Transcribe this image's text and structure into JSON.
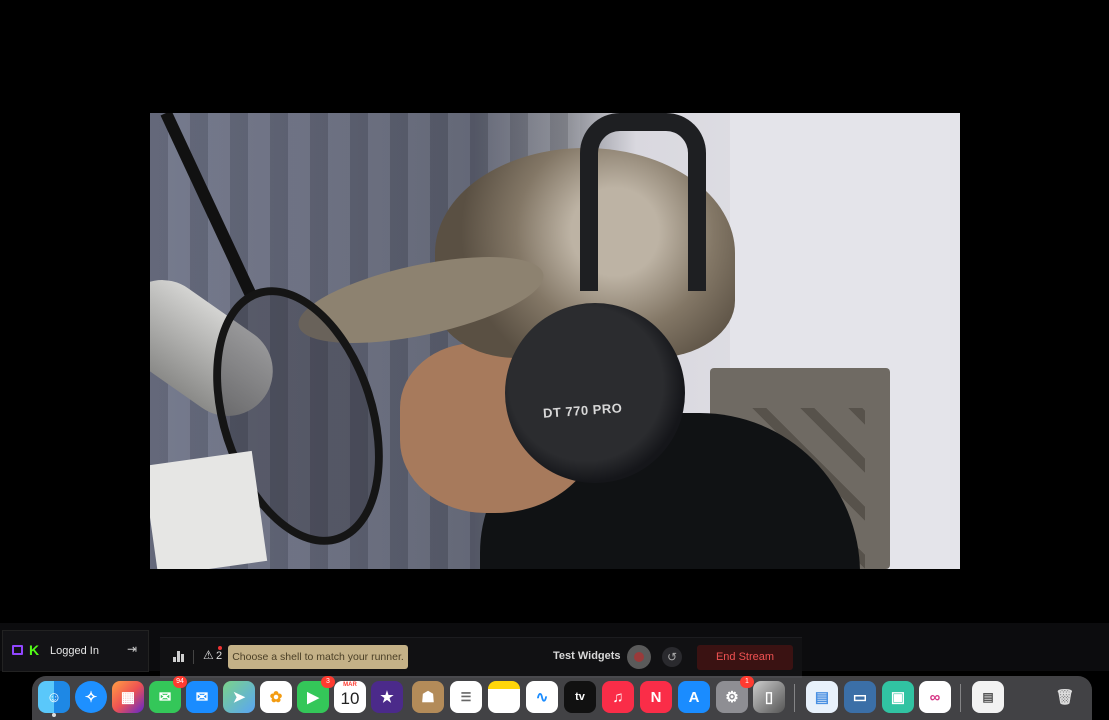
{
  "stream_panel": {
    "headphone_brand_text": "DT 770 PRO"
  },
  "login": {
    "status_label": "Logged In"
  },
  "controls": {
    "warning_count": "2",
    "shell_hint": "Choose a shell to match your runner.",
    "test_widgets_label": "Test Widgets",
    "end_stream_label": "End Stream"
  },
  "dock": {
    "apps": [
      {
        "name": "finder-icon"
      },
      {
        "name": "safari-icon"
      },
      {
        "name": "launchpad-icon"
      },
      {
        "name": "messages-icon",
        "badge": "94"
      },
      {
        "name": "mail-icon"
      },
      {
        "name": "maps-icon"
      },
      {
        "name": "photos-icon"
      },
      {
        "name": "facetime-icon",
        "badge": "3"
      },
      {
        "name": "calendar-icon",
        "month": "MAR",
        "day": "10"
      },
      {
        "name": "imovie-icon"
      },
      {
        "name": "contacts-icon"
      },
      {
        "name": "reminders-icon"
      },
      {
        "name": "notes-icon"
      },
      {
        "name": "freeform-icon"
      },
      {
        "name": "apple-tv-icon",
        "label": "tv"
      },
      {
        "name": "music-icon"
      },
      {
        "name": "news-icon"
      },
      {
        "name": "app-store-icon"
      },
      {
        "name": "system-settings-icon",
        "badge": "1"
      },
      {
        "name": "iphone-mirroring-icon"
      },
      {
        "name": "preview-icon"
      },
      {
        "name": "screen-sharing-icon"
      },
      {
        "name": "streamlabs-icon"
      },
      {
        "name": "link-app-icon"
      },
      {
        "name": "document-icon"
      },
      {
        "name": "trash-icon"
      }
    ]
  },
  "colors": {
    "end_stream_text": "#f05252",
    "hint_background": "#c4b187",
    "kick_green": "#53fc18",
    "twitch_purple": "#9146ff"
  }
}
